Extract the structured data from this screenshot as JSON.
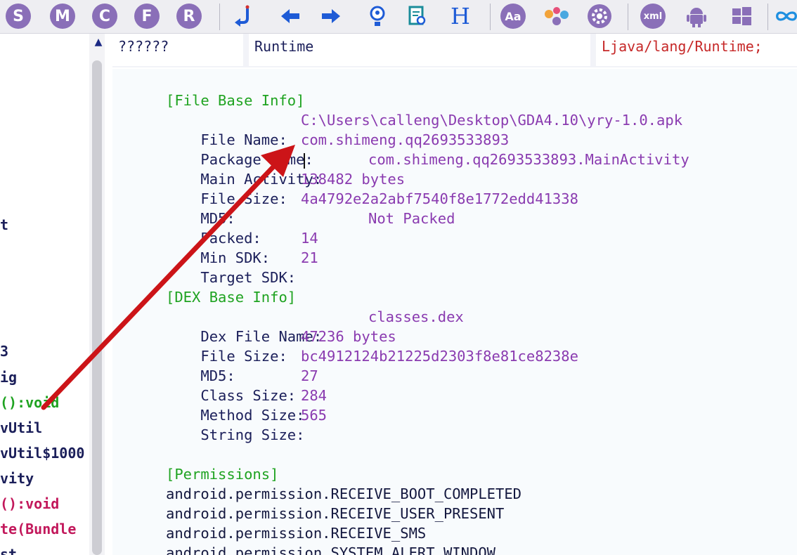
{
  "toolbar": {
    "buttons": [
      {
        "name": "s-button",
        "letter": "S"
      },
      {
        "name": "m-button",
        "letter": "M"
      },
      {
        "name": "c-button",
        "letter": "C"
      },
      {
        "name": "f-button",
        "letter": "F"
      },
      {
        "name": "r-button",
        "letter": "R"
      }
    ],
    "xml_label": "xml",
    "aa_label": "Aa",
    "h_label": "H"
  },
  "tree": {
    "lines": [
      {
        "text": "t",
        "color": "#1b1f5a"
      },
      {
        "text": "3",
        "color": "#1b1f5a"
      },
      {
        "text": "ig",
        "color": "#1b1f5a"
      },
      {
        "text": "():void",
        "color": "#1fa321"
      },
      {
        "text": "vUtil",
        "color": "#1b1f5a"
      },
      {
        "text": "vUtil$1000",
        "color": "#1b1f5a"
      },
      {
        "text": "vity",
        "color": "#1b1f5a"
      },
      {
        "text": "():void",
        "color": "#c2185b"
      },
      {
        "text": "te(Bundle",
        "color": "#c2185b"
      },
      {
        "text": "st",
        "color": "#1b1f5a"
      }
    ]
  },
  "header": {
    "field1": "??????",
    "field2": "Runtime",
    "field3": "Ljava/lang/Runtime;",
    "field3_color": "#c62828"
  },
  "file_info": {
    "title": "[File Base Info]",
    "rows": [
      {
        "label": "File Name:",
        "value": "C:\\Users\\calleng\\Desktop\\GDA4.10\\yry-1.0.apk"
      },
      {
        "label": "Package Name:",
        "value": "com.shimeng.qq2693533893"
      },
      {
        "label": "Main Activity:",
        "value": "com.shimeng.qq2693533893.MainActivity"
      },
      {
        "label": "File Size:",
        "value": "138482 bytes"
      },
      {
        "label": "MD5:",
        "value": "4a4792e2a2abf7540f8e1772edd41338"
      },
      {
        "label": "Packed:",
        "value": "Not Packed"
      },
      {
        "label": "Min SDK:",
        "value": "14"
      },
      {
        "label": "Target SDK:",
        "value": "21"
      }
    ]
  },
  "dex_info": {
    "title": "[DEX Base Info]",
    "rows": [
      {
        "label": "Dex File Name:",
        "value": "classes.dex"
      },
      {
        "label": "File Size:",
        "value": "47236 bytes"
      },
      {
        "label": "MD5:",
        "value": "bc4912124b21225d2303f8e81ce8238e"
      },
      {
        "label": "Class Size:",
        "value": "27"
      },
      {
        "label": "Method Size:",
        "value": "284"
      },
      {
        "label": "String Size:",
        "value": "565"
      }
    ]
  },
  "permissions": {
    "title": "[Permissions]",
    "items": [
      "android.permission.RECEIVE_BOOT_COMPLETED",
      "android.permission.RECEIVE_USER_PRESENT",
      "android.permission.RECEIVE_SMS",
      "android.permission.SYSTEM_ALERT_WINDOW"
    ]
  },
  "colors": {
    "label": "#1b1f5a",
    "value": "#8a3bb0",
    "section": "#1fa321",
    "arrow": "#cc1418",
    "icon_purple": "#8a6fb8",
    "icon_blue": "#1e5bd6"
  }
}
